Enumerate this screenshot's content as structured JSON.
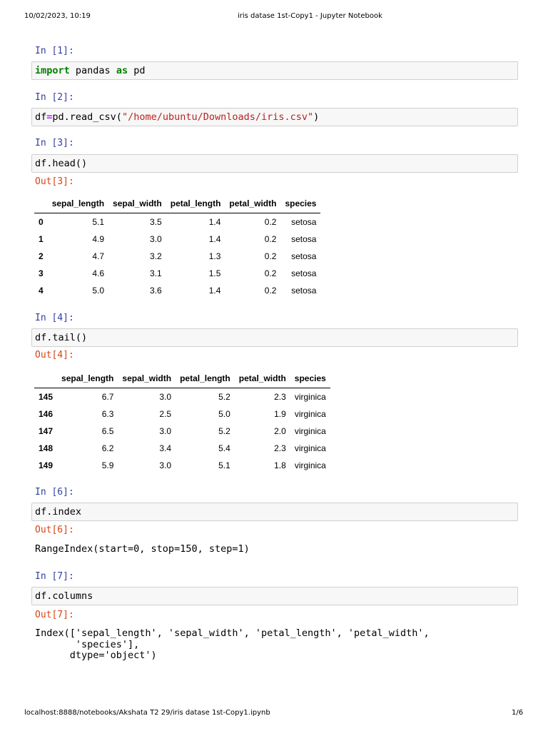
{
  "header": {
    "datetime": "10/02/2023, 10:19",
    "title": "iris datase 1st-Copy1 - Jupyter Notebook"
  },
  "footer": {
    "url": "localhost:8888/notebooks/Akshata T2 29/iris datase 1st-Copy1.ipynb",
    "page": "1/6"
  },
  "cells": [
    {
      "prompt": "In [1]:",
      "code": {
        "kw1": "import",
        "mid": " pandas ",
        "kw2": "as",
        "end": " pd"
      }
    },
    {
      "prompt": "In [2]:",
      "code": {
        "a": "df",
        "op": "=",
        "b": "pd.read_csv(",
        "str": "\"/home/ubuntu/Downloads/iris.csv\"",
        "c": ")"
      }
    },
    {
      "prompt": "In [3]:",
      "code": "df.head()",
      "out_prompt": "Out[3]:"
    },
    {
      "prompt": "In [4]:",
      "code": "df.tail()",
      "out_prompt": "Out[4]:"
    },
    {
      "prompt": "In [6]:",
      "code": "df.index",
      "out_prompt": "Out[6]:",
      "output": "RangeIndex(start=0, stop=150, step=1)"
    },
    {
      "prompt": "In [7]:",
      "code": "df.columns",
      "out_prompt": "Out[7]:",
      "output": "Index(['sepal_length', 'sepal_width', 'petal_length', 'petal_width',\n       'species'],\n      dtype='object')"
    }
  ],
  "tables": {
    "columns": [
      "",
      "sepal_length",
      "sepal_width",
      "petal_length",
      "petal_width",
      "species"
    ],
    "head": [
      [
        "0",
        "5.1",
        "3.5",
        "1.4",
        "0.2",
        "setosa"
      ],
      [
        "1",
        "4.9",
        "3.0",
        "1.4",
        "0.2",
        "setosa"
      ],
      [
        "2",
        "4.7",
        "3.2",
        "1.3",
        "0.2",
        "setosa"
      ],
      [
        "3",
        "4.6",
        "3.1",
        "1.5",
        "0.2",
        "setosa"
      ],
      [
        "4",
        "5.0",
        "3.6",
        "1.4",
        "0.2",
        "setosa"
      ]
    ],
    "tail": [
      [
        "145",
        "6.7",
        "3.0",
        "5.2",
        "2.3",
        "virginica"
      ],
      [
        "146",
        "6.3",
        "2.5",
        "5.0",
        "1.9",
        "virginica"
      ],
      [
        "147",
        "6.5",
        "3.0",
        "5.2",
        "2.0",
        "virginica"
      ],
      [
        "148",
        "6.2",
        "3.4",
        "5.4",
        "2.3",
        "virginica"
      ],
      [
        "149",
        "5.9",
        "3.0",
        "5.1",
        "1.8",
        "virginica"
      ]
    ]
  }
}
